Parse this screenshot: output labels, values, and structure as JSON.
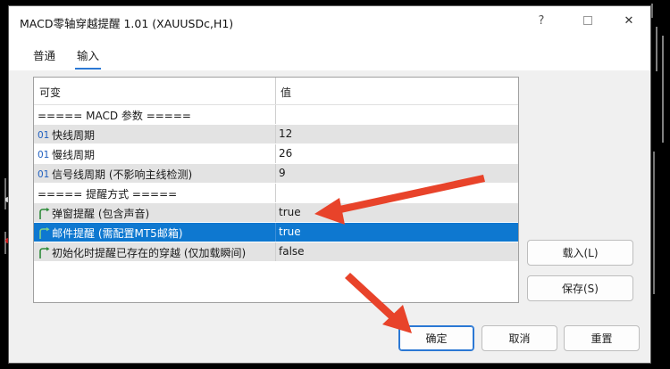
{
  "window": {
    "title": "MACD零轴穿越提醒 1.01 (XAUUSDc,H1)",
    "help_label": "?",
    "close_label": "✕"
  },
  "tabs": [
    {
      "label": "普通",
      "active": false
    },
    {
      "label": "输入",
      "active": true
    }
  ],
  "grid": {
    "col_variable": "可变",
    "col_value": "值",
    "rows": [
      {
        "prefix": "",
        "icon": "none",
        "name": "===== MACD 参数 =====",
        "value": "",
        "style": "plain"
      },
      {
        "prefix": "01",
        "icon": "number-icon",
        "name": "快线周期",
        "value": "12",
        "style": "shaded"
      },
      {
        "prefix": "01",
        "icon": "number-icon",
        "name": "慢线周期",
        "value": "26",
        "style": "plain"
      },
      {
        "prefix": "01",
        "icon": "number-icon",
        "name": "信号线周期 (不影响主线检测)",
        "value": "9",
        "style": "shaded"
      },
      {
        "prefix": "",
        "icon": "none",
        "name": "===== 提醒方式 =====",
        "value": "",
        "style": "plain"
      },
      {
        "prefix": "",
        "icon": "bool-arrow-icon",
        "name": "弹窗提醒 (包含声音)",
        "value": "true",
        "style": "shaded"
      },
      {
        "prefix": "",
        "icon": "bool-arrow-icon",
        "name": "邮件提醒 (需配置MT5邮箱)",
        "value": "true",
        "style": "selected"
      },
      {
        "prefix": "",
        "icon": "bool-arrow-icon",
        "name": "初始化时提醒已存在的穿越 (仅加载瞬间)",
        "value": "false",
        "style": "shaded"
      }
    ]
  },
  "side_buttons": {
    "load_label": "载入(L)",
    "save_label": "保存(S)"
  },
  "footer_buttons": {
    "ok_label": "确定",
    "cancel_label": "取消",
    "reset_label": "重置"
  },
  "colors": {
    "selection": "#0e78d0",
    "annotation_arrow": "#e8432a",
    "bool_icon": "#2e8b3a"
  }
}
